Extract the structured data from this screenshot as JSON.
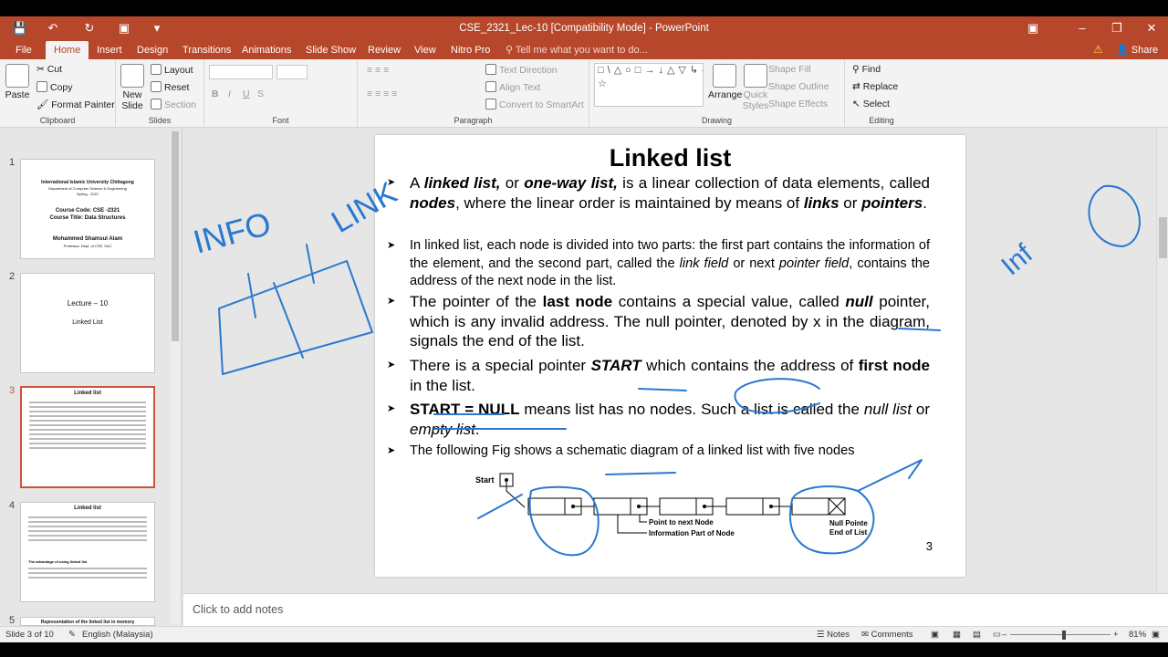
{
  "window": {
    "title": "CSE_2321_Lec-10 [Compatibility Mode] - PowerPoint"
  },
  "tabs": [
    {
      "label": "File"
    },
    {
      "label": "Home"
    },
    {
      "label": "Insert"
    },
    {
      "label": "Design"
    },
    {
      "label": "Transitions"
    },
    {
      "label": "Animations"
    },
    {
      "label": "Slide Show"
    },
    {
      "label": "Review"
    },
    {
      "label": "View"
    },
    {
      "label": "Nitro Pro"
    }
  ],
  "tellme": "Tell me what you want to do...",
  "share": "Share",
  "ribbon": {
    "clipboard": {
      "label": "Clipboard",
      "paste": "Paste",
      "cut": "Cut",
      "copy": "Copy",
      "format_painter": "Format Painter"
    },
    "slides": {
      "label": "Slides",
      "new_slide": "New Slide",
      "layout": "Layout",
      "reset": "Reset",
      "section": "Section"
    },
    "font": {
      "label": "Font"
    },
    "paragraph": {
      "label": "Paragraph",
      "text_direction": "Text Direction",
      "align_text": "Align Text",
      "smartart": "Convert to SmartArt"
    },
    "drawing": {
      "label": "Drawing",
      "arrange": "Arrange",
      "quick_styles": "Quick Styles",
      "shape_fill": "Shape Fill",
      "shape_outline": "Shape Outline",
      "shape_effects": "Shape Effects"
    },
    "editing": {
      "label": "Editing",
      "find": "Find",
      "replace": "Replace",
      "select": "Select"
    }
  },
  "thumbnails": [
    {
      "num": "1",
      "lines": [
        "International Islamic University Chittagong",
        "Department of Computer Science & Engineering",
        "Spring - 2021",
        "Course Code: CSE -2321",
        "Course Title: Data Structures",
        "Mohammed Shamsul Alam",
        "Professor, Dept. of CSE, IIUC"
      ]
    },
    {
      "num": "2",
      "lines": [
        "Lecture – 10",
        "Linked List"
      ]
    },
    {
      "num": "3",
      "title": "Linked list"
    },
    {
      "num": "4",
      "title": "Linked list",
      "lines": [
        "The advantage of using linked list"
      ]
    },
    {
      "num": "5",
      "title": "Representation of the linked list in memory"
    }
  ],
  "slide": {
    "title": "Linked list",
    "number": "3",
    "bullets": {
      "b1": {
        "a": "A ",
        "linked": "linked list,",
        "or": " or ",
        "oneway": "one-way list,",
        "rest1": " is a linear collection of data elements, called ",
        "nodes": "nodes",
        "rest2": ", where the linear order is maintained by means of ",
        "links": "links",
        "or2": " or ",
        "pointers": "pointers",
        "end": "."
      },
      "b2": {
        "t1": "In linked list, each node is divided into two parts: the first part contains the information of the element, and the second part, called the ",
        "lf": "link field",
        "t2": " or next ",
        "pf": "pointer field",
        "t3": ", contains the address of the next node in the list."
      },
      "b3": {
        "t1": "The pointer of the ",
        "ln": "last node",
        "t2": " contains a special value, called ",
        "null": "null",
        "t3": " pointer, which is any invalid address. The null pointer, denoted by x in the diagram, signals the end of the list."
      },
      "b4": {
        "t1": "There is a special pointer ",
        "start": "START",
        "t2": " which contains the address of ",
        "fn": "first node",
        "t3": " in the list."
      },
      "b5": {
        "sn": "START = NULL",
        "t1": " means list has no nodes. Such a list is called the ",
        "nl": "null list",
        "t2": " or ",
        "el": "empty list",
        "t3": "."
      },
      "b6": {
        "t1": "The following Fig shows a schematic diagram of a linked list with five nodes"
      }
    },
    "diagram": {
      "start_label": "Start",
      "ptr_label": "Point to next Node",
      "info_label": "Information Part of Node",
      "null_label1": "Null Pointer",
      "null_label2": "End of List"
    },
    "ink_text": {
      "info": "INFO",
      "link": "LINK",
      "inf": "Inf"
    }
  },
  "notes": "Click to add notes",
  "status": {
    "slide": "Slide 3 of 10",
    "lang": "English (Malaysia)",
    "notes": "Notes",
    "comments": "Comments",
    "zoom": "81%"
  }
}
